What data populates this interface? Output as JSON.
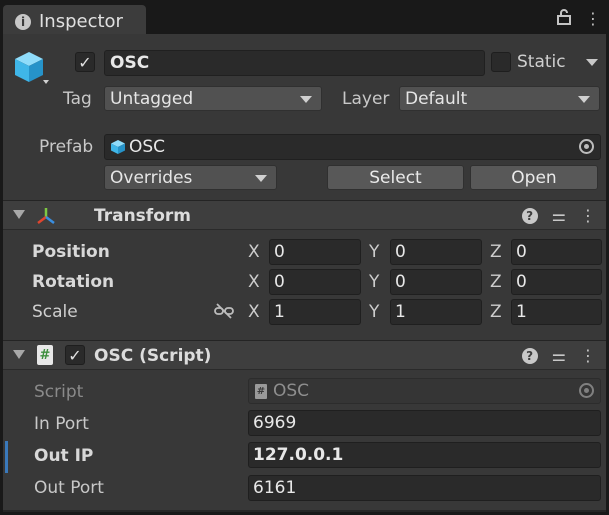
{
  "window": {
    "tab_label": "Inspector",
    "icons": [
      "info-icon",
      "lock-icon",
      "more-icon"
    ]
  },
  "gameobject": {
    "active": true,
    "name": "OSC",
    "static_label": "Static",
    "static_checked": false,
    "tag_label": "Tag",
    "tag_value": "Untagged",
    "layer_label": "Layer",
    "layer_value": "Default",
    "prefab_label": "Prefab",
    "prefab_value": "OSC",
    "overrides_label": "Overrides",
    "select_label": "Select",
    "open_label": "Open"
  },
  "transform": {
    "title": "Transform",
    "position_label": "Position",
    "rotation_label": "Rotation",
    "scale_label": "Scale",
    "axis_x": "X",
    "axis_y": "Y",
    "axis_z": "Z",
    "position": {
      "x": "0",
      "y": "0",
      "z": "0"
    },
    "rotation": {
      "x": "0",
      "y": "0",
      "z": "0"
    },
    "scale": {
      "x": "1",
      "y": "1",
      "z": "1"
    }
  },
  "script_component": {
    "title": "OSC (Script)",
    "enabled": true,
    "script_label": "Script",
    "script_value": "OSC",
    "in_port_label": "In Port",
    "in_port_value": "6969",
    "out_ip_label": "Out IP",
    "out_ip_value": "127.0.0.1",
    "out_port_label": "Out Port",
    "out_port_value": "6161"
  },
  "colors": {
    "panel": "#383838",
    "field": "#2a2a2a",
    "accent": "#3a79bb",
    "cube": "#3fb6e8"
  }
}
